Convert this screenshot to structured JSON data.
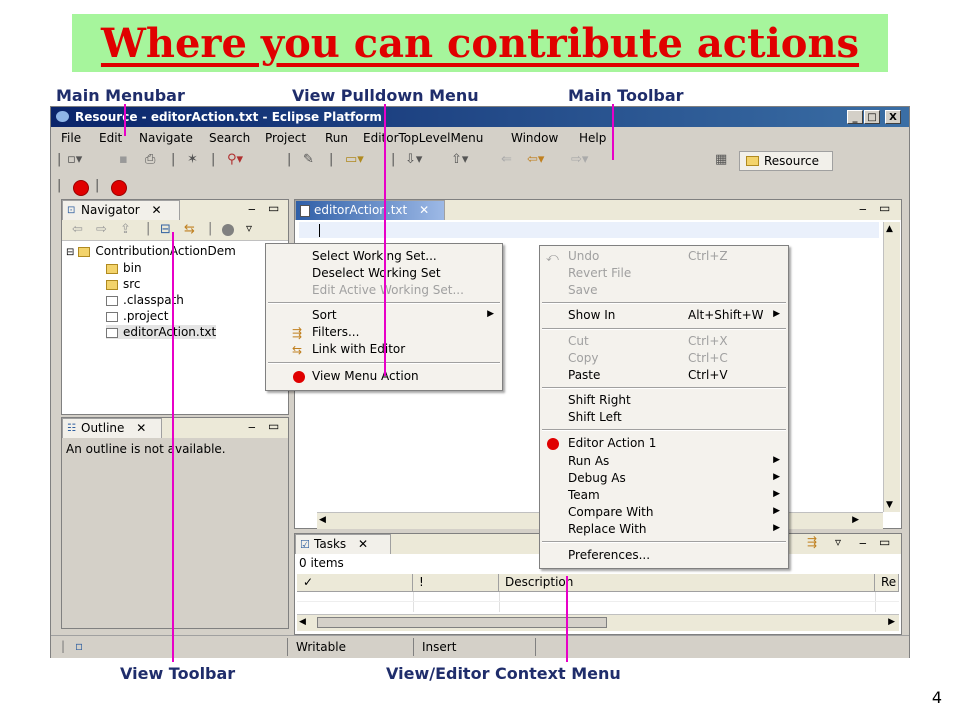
{
  "slide": {
    "title": "Where you can contribute actions",
    "page_number": "4"
  },
  "callouts": {
    "main_menubar": "Main Menubar",
    "view_pulldown_menu": "View Pulldown Menu",
    "main_toolbar": "Main Toolbar",
    "view_toolbar": "View Toolbar",
    "view_editor_context_menu": "View/Editor Context Menu"
  },
  "window": {
    "title": "Resource - editorAction.txt - Eclipse Platform",
    "minimize": "_",
    "maximize": "□",
    "close": "X"
  },
  "menubar": [
    "File",
    "Edit",
    "Navigate",
    "Search",
    "Project",
    "Run",
    "EditorTopLevelMenu",
    "Window",
    "Help"
  ],
  "perspective": {
    "label": "Resource"
  },
  "navigator": {
    "tab_label": "Navigator",
    "tree": [
      {
        "label": "ContributionActionDem",
        "kind": "project"
      },
      {
        "label": "bin",
        "kind": "folder"
      },
      {
        "label": "src",
        "kind": "folder"
      },
      {
        "label": ".classpath",
        "kind": "file"
      },
      {
        "label": ".project",
        "kind": "file"
      },
      {
        "label": "editorAction.txt",
        "kind": "file"
      }
    ]
  },
  "outline": {
    "tab_label": "Outline",
    "message": "An outline is not available."
  },
  "editor": {
    "tab_label": "editorAction.txt"
  },
  "view_menu": {
    "items": [
      {
        "label": "Select Working Set...",
        "disabled": false
      },
      {
        "label": "Deselect Working Set",
        "disabled": false
      },
      {
        "label": "Edit Active Working Set...",
        "disabled": true
      },
      {
        "label": "Sort",
        "disabled": false,
        "submenu": true
      },
      {
        "label": "Filters...",
        "disabled": false
      },
      {
        "label": "Link with Editor",
        "disabled": false
      },
      {
        "label": "View Menu Action",
        "disabled": false
      }
    ]
  },
  "context_menu": {
    "items": [
      {
        "label": "Undo",
        "accel": "Ctrl+Z",
        "disabled": true
      },
      {
        "label": "Revert File",
        "accel": "",
        "disabled": true
      },
      {
        "label": "Save",
        "accel": "",
        "disabled": true
      },
      {
        "label": "Show In",
        "accel": "Alt+Shift+W",
        "disabled": false,
        "submenu": true
      },
      {
        "label": "Cut",
        "accel": "Ctrl+X",
        "disabled": true
      },
      {
        "label": "Copy",
        "accel": "Ctrl+C",
        "disabled": true
      },
      {
        "label": "Paste",
        "accel": "Ctrl+V",
        "disabled": false
      },
      {
        "label": "Shift Right",
        "accel": "",
        "disabled": false
      },
      {
        "label": "Shift Left",
        "accel": "",
        "disabled": false
      },
      {
        "label": "Editor Action 1",
        "accel": "",
        "disabled": false
      },
      {
        "label": "Run As",
        "accel": "",
        "disabled": false,
        "submenu": true
      },
      {
        "label": "Debug As",
        "accel": "",
        "disabled": false,
        "submenu": true
      },
      {
        "label": "Team",
        "accel": "",
        "disabled": false,
        "submenu": true
      },
      {
        "label": "Compare With",
        "accel": "",
        "disabled": false,
        "submenu": true
      },
      {
        "label": "Replace With",
        "accel": "",
        "disabled": false,
        "submenu": true
      },
      {
        "label": "Preferences...",
        "accel": "",
        "disabled": false
      }
    ]
  },
  "tasks": {
    "tab_label": "Tasks",
    "count_text": "0 items",
    "columns": [
      "✓",
      "!",
      "Description",
      "Re"
    ]
  },
  "statusbar": {
    "writable": "Writable",
    "insert": "Insert"
  },
  "colors": {
    "title_red": "#e00000",
    "banner_green": "#a6f59c",
    "callout_magenta": "#e800c8",
    "callout_text": "#1f2d6b"
  }
}
